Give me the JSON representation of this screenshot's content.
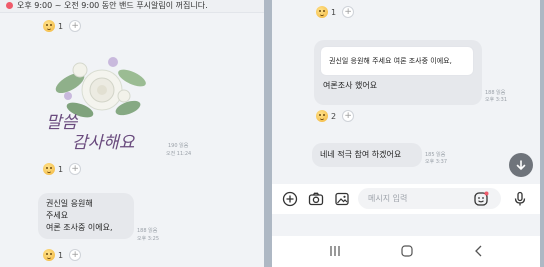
{
  "left": {
    "banner_text": "오후 9:00 ~ 오전 9:00 동안 밴드 푸시알림이 꺼집니다.",
    "reaction_top": {
      "count": "1"
    },
    "sticker": {
      "text_line1": "말씀",
      "text_line2": "감사해요",
      "read_count": "190 읽음",
      "time": "오전 11:24"
    },
    "reaction_mid": {
      "count": "1"
    },
    "message": {
      "line1": "권신일 응원해",
      "line2": "주세요",
      "line3": "여론 조사중 이에요,",
      "read_count": "188 읽음",
      "time": "오후 3:25"
    },
    "reaction_bottom": {
      "count": "1"
    }
  },
  "right": {
    "reaction_top": {
      "count": "1"
    },
    "quote": {
      "quoted_text": "권신일 응원해 주세요 여론 조사중 이에요,",
      "reply_text": "여론조사 했어요",
      "read_count": "188 읽음",
      "time": "오후 3:31"
    },
    "reaction_mid": {
      "count": "2"
    },
    "reply": {
      "text": "네네 적극 참여 하겠어요",
      "read_count": "185 읽음",
      "time": "오후 3:37"
    },
    "input_placeholder": "메시지 입력"
  },
  "colors": {
    "accent_red": "#ef5b6b",
    "bubble": "#e6e8ec",
    "fab": "#6f747b"
  },
  "icons": [
    "plus-circle-icon",
    "camera-icon",
    "image-icon",
    "emoji-icon",
    "microphone-icon",
    "arrow-down-icon",
    "recent-apps-icon",
    "home-icon",
    "back-icon"
  ]
}
